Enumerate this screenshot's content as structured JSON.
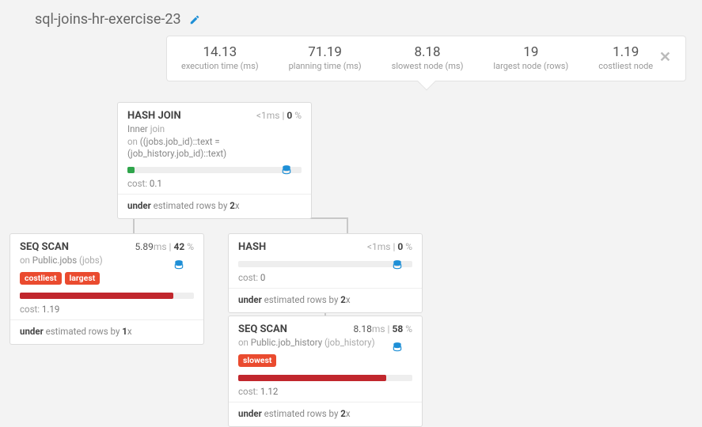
{
  "header": {
    "title": "sql-joins-hr-exercise-23"
  },
  "stats": {
    "execution_val": "14.13",
    "execution_lbl": "execution time (ms)",
    "planning_val": "71.19",
    "planning_lbl": "planning time (ms)",
    "slowest_val": "8.18",
    "slowest_lbl": "slowest node (ms)",
    "largest_val": "19",
    "largest_lbl": "largest node (rows)",
    "costliest_val": "1.19",
    "costliest_lbl": "costliest node"
  },
  "nodes": {
    "hashjoin": {
      "type": "HASH JOIN",
      "time_pre": "<1",
      "time_unit": "ms",
      "pct": "0",
      "sub1a": "Inner ",
      "sub1b": "join",
      "sub2a": "on ",
      "sub2b": "((jobs.job_id)::text = (job_history.job_id)::text)",
      "cost_lbl": "cost: ",
      "cost_val": "0.1",
      "est_a": "under",
      "est_b": " estimated rows by ",
      "est_c": "2",
      "est_d": "x"
    },
    "seqscan1": {
      "type": "SEQ SCAN",
      "time_val": "5.89",
      "time_unit": "ms",
      "pct": "42",
      "sub_a": "on ",
      "sub_b": "Public.jobs ",
      "sub_c": "(jobs)",
      "tag1": "costliest",
      "tag2": "largest",
      "cost_lbl": "cost: ",
      "cost_val": "1.19",
      "est_a": "under",
      "est_b": " estimated rows by ",
      "est_c": "1",
      "est_d": "x"
    },
    "hash": {
      "type": "HASH",
      "time_pre": "<1",
      "time_unit": "ms",
      "pct": "0",
      "cost_lbl": "cost: ",
      "cost_val": "0",
      "est_a": "under",
      "est_b": " estimated rows by ",
      "est_c": "2",
      "est_d": "x"
    },
    "seqscan2": {
      "type": "SEQ SCAN",
      "time_val": "8.18",
      "time_unit": "ms",
      "pct": "58",
      "sub_a": "on ",
      "sub_b": "Public.job_history ",
      "sub_c": "(job_history)",
      "tag1": "slowest",
      "cost_lbl": "cost: ",
      "cost_val": "1.12",
      "est_a": "under",
      "est_b": " estimated rows by ",
      "est_c": "2",
      "est_d": "x"
    }
  }
}
